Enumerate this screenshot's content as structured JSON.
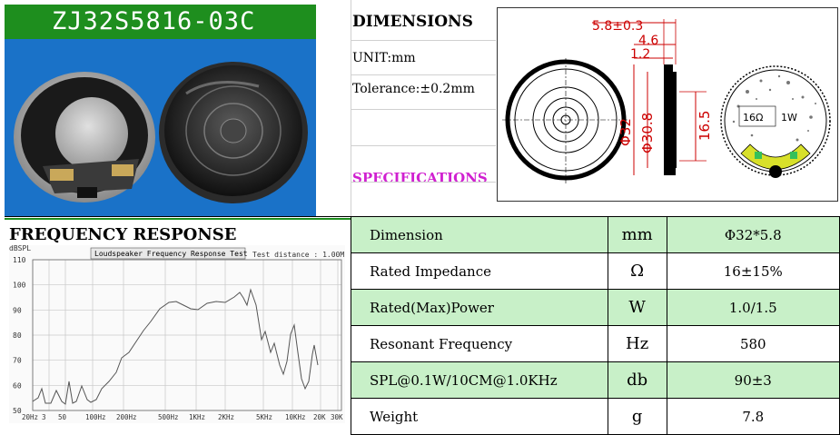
{
  "title": "ZJ32S5816-03C",
  "dimensions": {
    "heading": "DIMENSIONS",
    "unit": "UNIT:mm",
    "tolerance": "Tolerance:±0.2mm"
  },
  "specifications_heading": "SPECIFICATIONS",
  "drawing_labels": {
    "total_depth": "5.8±0.3",
    "depth_4_6": "4.6",
    "depth_1_2": "1.2",
    "outer_dia": "Φ32",
    "inner_dia": "Φ30.8",
    "terminal_height": "16.5",
    "impedance_mark": "16Ω",
    "power_mark": "1W"
  },
  "frequency_response": {
    "heading": "FREQUENCY RESPONSE",
    "graph_title": "Loudspeaker Frequency Response Test",
    "test_distance": "Test distance : 1.00M",
    "y_unit": "dBSPL",
    "y_ticks": [
      "110",
      "100",
      "90",
      "80",
      "70",
      "60",
      "50"
    ],
    "x_ticks": [
      "20Hz",
      "3",
      "50",
      "100Hz",
      "200Hz",
      "500Hz",
      "1KHz",
      "2KHz",
      "5KHz",
      "10KHz",
      "20K",
      "30K"
    ]
  },
  "spec_table": [
    {
      "param": "Dimension",
      "unit": "mm",
      "value": "Φ32*5.8"
    },
    {
      "param": "Rated Impedance",
      "unit": "Ω",
      "value": "16±15%"
    },
    {
      "param": "Rated(Max)Power",
      "unit": "W",
      "value": "1.0/1.5"
    },
    {
      "param": "Resonant Frequency",
      "unit": "Hz",
      "value": "580"
    },
    {
      "param": "SPL@0.1W/10CM@1.0KHz",
      "unit": "db",
      "value": "90±3"
    },
    {
      "param": "Weight",
      "unit": "g",
      "value": "7.8"
    }
  ],
  "colors": {
    "title_bg": "#1e8e1e",
    "spec_heading": "#d020d0",
    "row_green": "#c8f0c8",
    "dim_red": "#cc0000"
  }
}
